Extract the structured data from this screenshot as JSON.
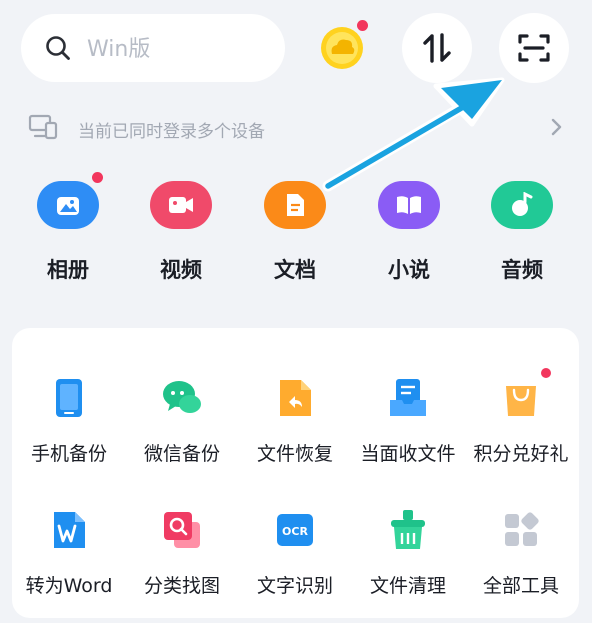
{
  "search": {
    "placeholder": "Win版"
  },
  "devices": {
    "text": "当前已同时登录多个设备"
  },
  "categories": [
    {
      "label": "相册",
      "color": "#2e8df5",
      "icon": "photo-album-icon",
      "badge": true
    },
    {
      "label": "视频",
      "color": "#f04a6a",
      "icon": "video-icon",
      "badge": false
    },
    {
      "label": "文档",
      "color": "#fb8a18",
      "icon": "document-icon",
      "badge": false
    },
    {
      "label": "小说",
      "color": "#8a5cf5",
      "icon": "book-icon",
      "badge": false
    },
    {
      "label": "音频",
      "color": "#21c996",
      "icon": "music-icon",
      "badge": false
    }
  ],
  "tools": {
    "row1": [
      {
        "label": "手机备份",
        "icon": "phone-backup-icon"
      },
      {
        "label": "微信备份",
        "icon": "wechat-backup-icon"
      },
      {
        "label": "文件恢复",
        "icon": "file-restore-icon"
      },
      {
        "label": "当面收文件",
        "icon": "receive-file-icon"
      },
      {
        "label": "积分兑好礼",
        "icon": "gift-bag-icon",
        "badge": true
      }
    ],
    "row2": [
      {
        "label": "转为Word",
        "icon": "word-convert-icon"
      },
      {
        "label": "分类找图",
        "icon": "image-search-icon"
      },
      {
        "label": "文字识别",
        "icon": "ocr-icon",
        "icon_text": "OCR"
      },
      {
        "label": "文件清理",
        "icon": "file-clean-icon"
      },
      {
        "label": "全部工具",
        "icon": "all-tools-icon"
      }
    ]
  },
  "colors": {
    "accent_blue": "#2e8df5",
    "badge_red": "#f2365d",
    "arrow": "#1aa3e0"
  }
}
